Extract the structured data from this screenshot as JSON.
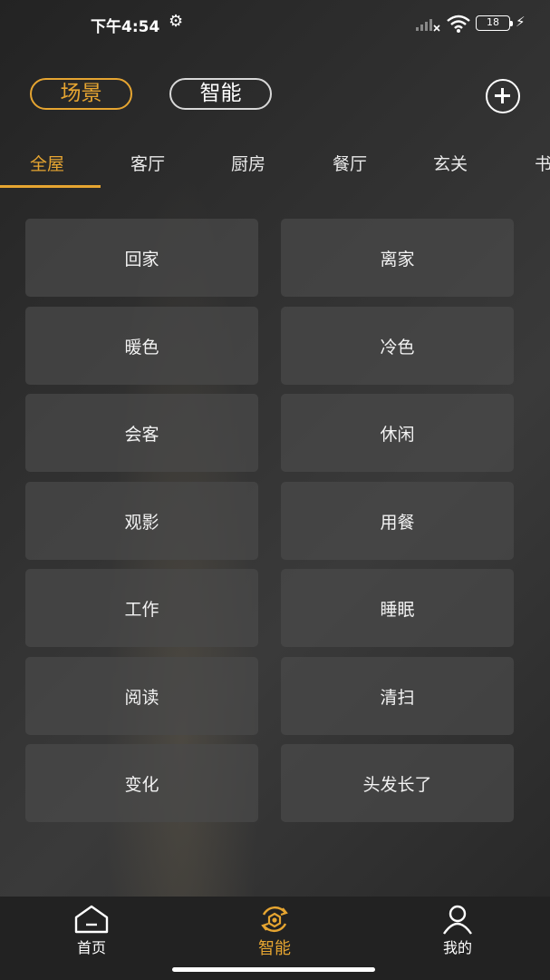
{
  "status_bar": {
    "time": "下午4:54",
    "gear_icon": "gear-icon",
    "battery": "18",
    "colors": {
      "text": "#ffffff"
    }
  },
  "header": {
    "segments": [
      {
        "label": "场景",
        "active": true
      },
      {
        "label": "智能",
        "active": false
      }
    ],
    "add_icon": "plus-circle-icon"
  },
  "rooms": {
    "tabs": [
      "全屋",
      "客厅",
      "厨房",
      "餐厅",
      "玄关",
      "书"
    ],
    "active_index": 0
  },
  "scenes": [
    "回家",
    "离家",
    "暖色",
    "冷色",
    "会客",
    "休闲",
    "观影",
    "用餐",
    "工作",
    "睡眠",
    "阅读",
    "清扫",
    "变化",
    "头发长了"
  ],
  "bottom_nav": {
    "items": [
      {
        "label": "首页",
        "icon": "home-icon",
        "active": false
      },
      {
        "label": "智能",
        "icon": "smart-icon",
        "active": true
      },
      {
        "label": "我的",
        "icon": "user-icon",
        "active": false
      }
    ]
  },
  "colors": {
    "accent": "#e6a531",
    "card": "#4a4a4a",
    "nav_bg": "#222222"
  }
}
